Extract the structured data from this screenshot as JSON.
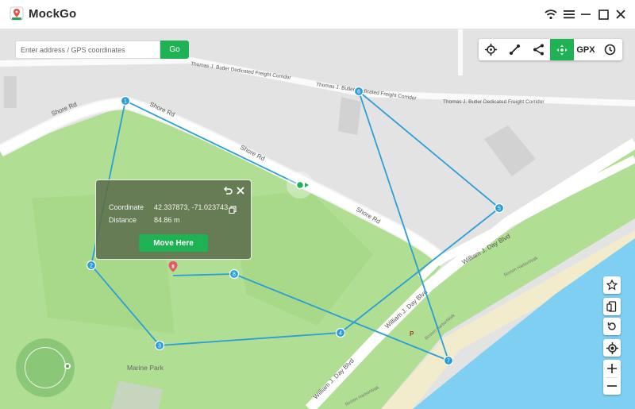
{
  "app": {
    "name": "MockGo"
  },
  "search": {
    "placeholder": "Enter address / GPS coordinates",
    "go_label": "Go"
  },
  "toolbar": {
    "gpx_label": "GPX",
    "active_tool": "joystick-mode"
  },
  "popup": {
    "coordinate_label": "Coordinate",
    "coordinate_value": "42.337873, -71.023743",
    "distance_label": "Distance",
    "distance_value": "84.86 m",
    "move_label": "Move Here"
  },
  "map": {
    "roads": {
      "shore_rd_1": "Shore Rd",
      "shore_rd_2": "Shore Rd",
      "shore_rd_3": "Shore Rd",
      "shore_rd_4": "Shore Rd",
      "corridor_1": "Thomas J. Butler Dedicated Freight Corridor",
      "corridor_2": "Thomas J. Butler Dedicated Freight Corridor",
      "corridor_3": "Thomas J. Butler Dedicated Freight Corridor",
      "day_blvd_1": "William J. Day Blvd",
      "day_blvd_2": "William J. Day Blvd",
      "day_blvd_3": "William J. Day Blvd",
      "harborwalk_1": "Boston HarborWalk",
      "harborwalk_2": "Boston HarborWalk",
      "harborwalk_3": "Boston HarborWalk"
    },
    "park_label": "Marine Park",
    "parking_label": "P",
    "waypoints": [
      {
        "label": "1"
      },
      {
        "label": "2"
      },
      {
        "label": "3"
      },
      {
        "label": "4"
      },
      {
        "label": "5"
      },
      {
        "label": "6"
      },
      {
        "label": "7"
      },
      {
        "label": "8"
      }
    ],
    "destination_marker_label": "8"
  },
  "colors": {
    "accent": "#1fb254",
    "route": "#2a9fd6",
    "park": "#aedc8f",
    "water": "#7ecff2",
    "road": "#ffffff"
  }
}
